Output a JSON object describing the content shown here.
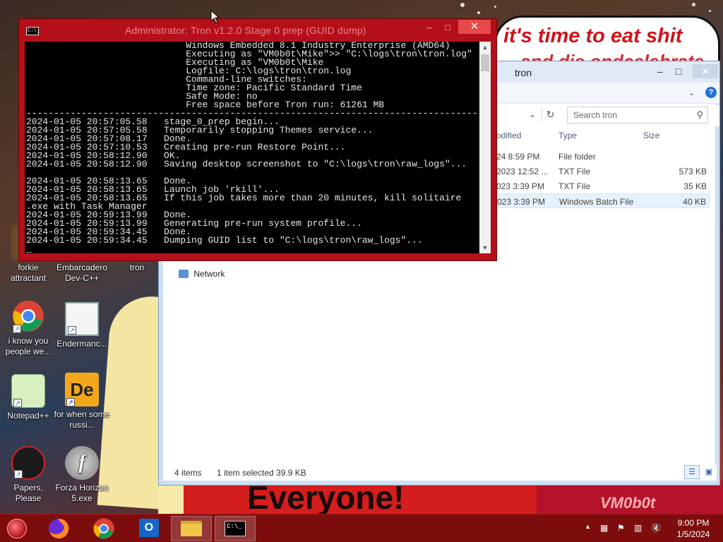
{
  "wallpaper": {
    "speech_line1": "it's time to eat shit",
    "speech_line2": "and die ondcelebrate",
    "banner": "Everyone!",
    "watermark": "VM0b0t"
  },
  "desktop_icons": [
    {
      "label": "forkie attractant",
      "icon": "forkie-icon"
    },
    {
      "label": "Embarcadero Dev-C++",
      "icon": "devcpp-icon"
    },
    {
      "label": "tron",
      "icon": "folder-icon"
    },
    {
      "label": "i know you people we...",
      "icon": "chrome-icon"
    },
    {
      "label": "Endermanc...",
      "icon": "window-app-icon"
    },
    {
      "label": "Notepad++",
      "icon": "notepadpp-icon"
    },
    {
      "label": "for when some russi...",
      "icon": "dev-icon"
    },
    {
      "label": "Papers, Please",
      "icon": "papers-please-icon"
    },
    {
      "label": "Forza Horizon 5.exe",
      "icon": "flash-icon"
    }
  ],
  "explorer": {
    "title": "tron",
    "search_placeholder": "Search tron",
    "columns": [
      "odified",
      "Type",
      "Size"
    ],
    "rows": [
      {
        "modified": "24 8:59 PM",
        "type": "File folder",
        "size": ""
      },
      {
        "modified": "2023 12:52 ...",
        "type": "TXT File",
        "size": "573 KB"
      },
      {
        "modified": "023 3:39 PM",
        "type": "TXT File",
        "size": "35 KB"
      },
      {
        "modified": "023 3:39 PM",
        "type": "Windows Batch File",
        "size": "40 KB"
      }
    ],
    "nav_network": "Network",
    "status_items": "4 items",
    "status_selected": "1 item selected  39.9 KB"
  },
  "cmd": {
    "title": "Administrator:  Tron v1.2.0 Stage 0 prep (GUID dump)",
    "lines": [
      "                             Windows Embedded 8.1 Industry Enterprise (AMD64)",
      "                             Executing as \"VM0b0t\\Mike\">> \"C:\\logs\\tron\\tron.log\"",
      "                             Executing as \"VM0b0t\\Mike",
      "                             Logfile: C:\\logs\\tron\\tron.log",
      "                             Command-line switches:",
      "                             Time zone: Pacific Standard Time",
      "                             Safe Mode: no",
      "                             Free space before Tron run: 61261 MB",
      "------------------------------------------------------------------------------------",
      "2024-01-05 20:57:05.58   stage_0_prep begin...",
      "2024-01-05 20:57:05.58   Temporarily stopping Themes service...",
      "2024-01-05 20:57:08.17   Done.",
      "2024-01-05 20:57:10.53   Creating pre-run Restore Point...",
      "2024-01-05 20:58:12.90   OK.",
      "2024-01-05 20:58:12.90   Saving desktop screenshot to \"C:\\logs\\tron\\raw_logs\"...",
      "",
      "2024-01-05 20:58:13.65   Done.",
      "2024-01-05 20:58:13.65   Launch job 'rkill'...",
      "2024-01-05 20:58:13.65   If this job takes more than 20 minutes, kill solitaire",
      ".exe with Task Manager",
      "2024-01-05 20:59:13.99   Done.",
      "2024-01-05 20:59:13.99   Generating pre-run system profile...",
      "2024-01-05 20:59:34.45   Done.",
      "2024-01-05 20:59:34.45   Dumping GUID list to \"C:\\logs\\tron\\raw_logs\"...",
      "_"
    ]
  },
  "taskbar": {
    "apps": [
      "firefox-icon",
      "chrome-icon",
      "outlook-icon",
      "file-explorer-icon",
      "cmd-icon"
    ],
    "time": "9:00 PM",
    "date": "1/5/2024"
  },
  "colors": {
    "cmd_border": "#b5101a",
    "taskbar": "#7d0d0d",
    "close_button": "#e84848"
  }
}
